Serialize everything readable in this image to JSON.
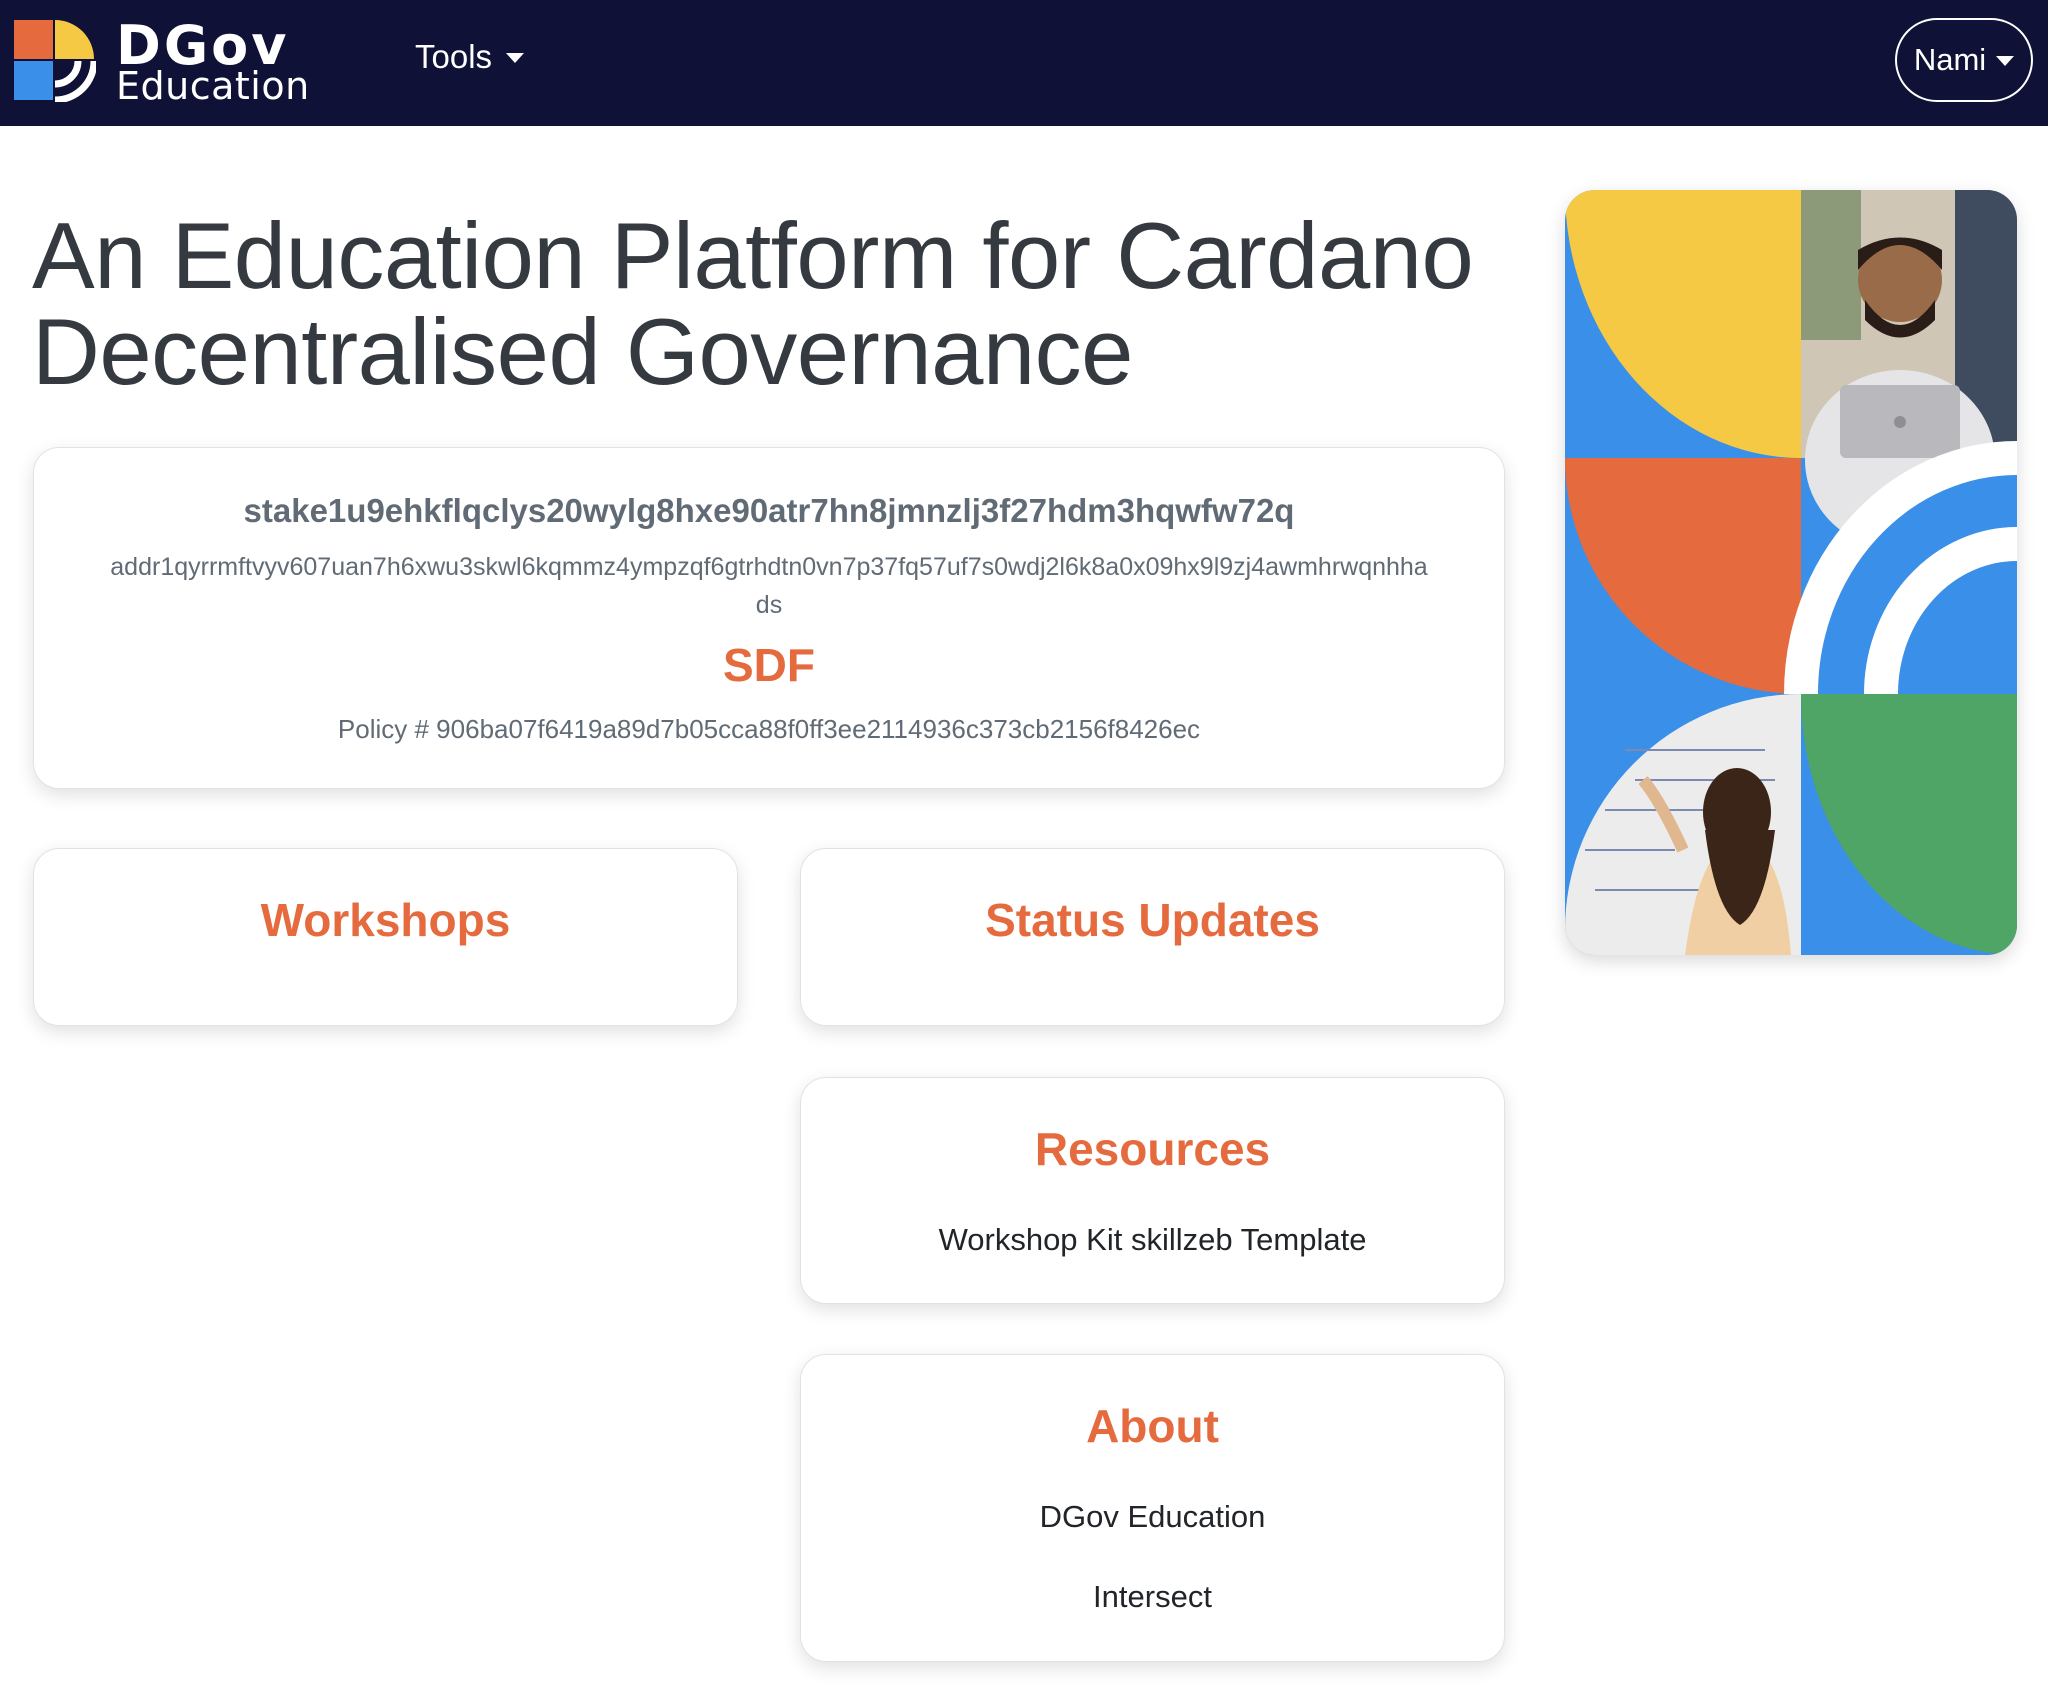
{
  "brand": {
    "title": "DGov",
    "subtitle": "Education",
    "logo_icon": "dgov-logo-icon"
  },
  "nav": {
    "tools_label": "Tools",
    "wallet_label": "Nami"
  },
  "hero": {
    "line1": "An Education Platform for Cardano",
    "line2": "Decentralised Governance"
  },
  "wallet_card": {
    "stake": "stake1u9ehkflqclys20wylg8hxe90atr7hn8jmnzlj3f27hdm3hqwfw72q",
    "address": "addr1qyrrmftvyv607uan7h6xwu3skwl6kqmmz4ympzqf6gtrhdtn0vn7p37fq57uf7s0wdj2l6k8a0x09hx9l9zj4awmhrwqnhhads",
    "org": "SDF",
    "policy": "Policy # 906ba07f6419a89d7b05cca88f0ff3ee2114936c373cb2156f8426ec"
  },
  "sections": {
    "workshops": {
      "title": "Workshops"
    },
    "status": {
      "title": "Status Updates"
    },
    "resources": {
      "title": "Resources",
      "link": "Workshop Kit skillzeb Template"
    },
    "about": {
      "title": "About",
      "links": [
        "DGov Education",
        "Intersect"
      ]
    }
  },
  "colors": {
    "nav_bg": "#0f1136",
    "accent": "#e56b3f",
    "yellow": "#f6c944",
    "blue": "#3a8fe8",
    "green": "#4fa566"
  }
}
